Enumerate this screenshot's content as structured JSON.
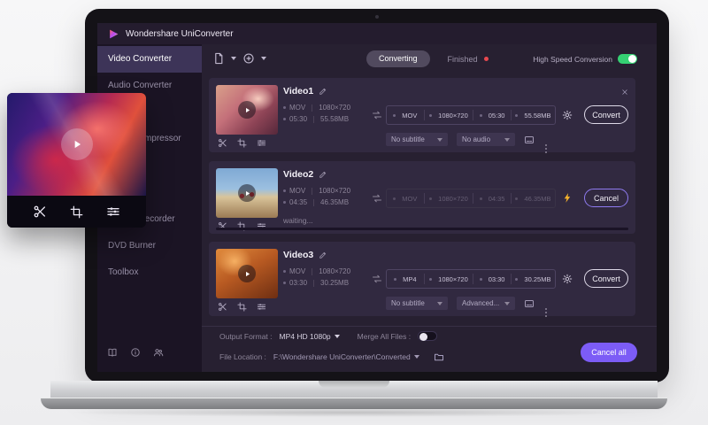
{
  "app": {
    "title": "Wondershare UniConverter"
  },
  "sidebar": {
    "items": [
      {
        "label": "Video Converter",
        "active": true
      },
      {
        "label": "Audio Converter",
        "active": false
      },
      {
        "label": "Video Compressor",
        "active": false
      },
      {
        "label": "Screen Recorder",
        "active": false
      },
      {
        "label": "DVD Burner",
        "active": false
      },
      {
        "label": "Toolbox",
        "active": false
      }
    ]
  },
  "toolbar": {
    "converting_tab": "Converting",
    "finished_tab": "Finished",
    "high_speed_label": "High Speed Conversion",
    "high_speed_on": true
  },
  "videos": [
    {
      "title": "Video1",
      "source": {
        "format": "MOV",
        "resolution": "1080×720",
        "duration": "05:30",
        "size": "55.58MB"
      },
      "target": {
        "format": "MOV",
        "resolution": "1080×720",
        "duration": "05:30",
        "size": "55.58MB"
      },
      "action": "Convert",
      "subtitle": "No subtitle",
      "audio": "No audio"
    },
    {
      "title": "Video2",
      "source": {
        "format": "MOV",
        "resolution": "1080×720",
        "duration": "04:35",
        "size": "46.35MB"
      },
      "target": {
        "format": "MOV",
        "resolution": "1080×720",
        "duration": "04:35",
        "size": "46.35MB"
      },
      "action": "Cancel",
      "status": "waiting..."
    },
    {
      "title": "Video3",
      "source": {
        "format": "MOV",
        "resolution": "1080×720",
        "duration": "03:30",
        "size": "30.25MB"
      },
      "target": {
        "format": "MP4",
        "resolution": "1080×720",
        "duration": "03:30",
        "size": "30.25MB"
      },
      "action": "Convert",
      "subtitle": "No subtitle",
      "audio": "Advanced..."
    }
  ],
  "footer": {
    "output_format_label": "Output Format :",
    "output_format_value": "MP4 HD 1080p",
    "merge_label": "Merge All Files :",
    "merge_on": false,
    "file_location_label": "File Location :",
    "file_location_value": "F:\\Wondershare UniConverter\\Converted",
    "cancel_all": "Cancel all"
  },
  "colors": {
    "accent": "#7c5cf6",
    "toggle_on": "#35d073",
    "finished_dot": "#e8484f",
    "bolt": "#f7b32b"
  }
}
